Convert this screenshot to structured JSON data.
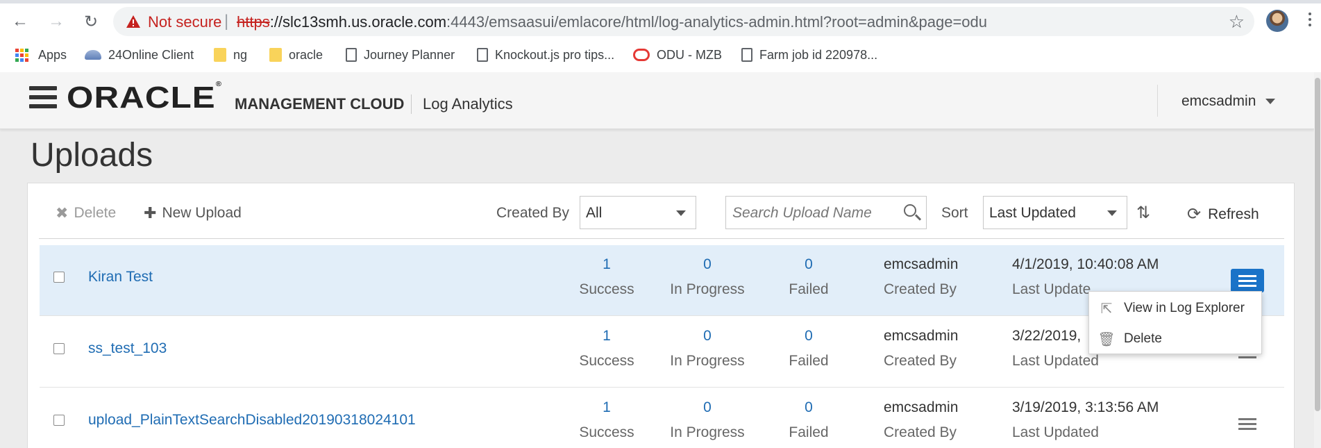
{
  "browser": {
    "security_label": "Not secure",
    "url_scheme": "https",
    "url_host": "://slc13smh.us.oracle.com",
    "url_rest": ":4443/emsaasui/emlacore/html/log-analytics-admin.html?root=admin&page=odu",
    "bookmarks": [
      {
        "label": "Apps",
        "icon": "apps-grid-icon"
      },
      {
        "label": "24Online Client",
        "icon": "cloud-icon"
      },
      {
        "label": "ng",
        "icon": "folder-icon"
      },
      {
        "label": "oracle",
        "icon": "folder-icon"
      },
      {
        "label": "Journey Planner",
        "icon": "page-icon"
      },
      {
        "label": "Knockout.js pro tips...",
        "icon": "page-icon"
      },
      {
        "label": "ODU - MZB",
        "icon": "oracle-o-icon"
      },
      {
        "label": "Farm job id 220978...",
        "icon": "page-icon"
      }
    ]
  },
  "header": {
    "logo": "ORACLE",
    "product": "MANAGEMENT CLOUD",
    "service": "Log Analytics",
    "user": "emcsadmin"
  },
  "page": {
    "title": "Uploads"
  },
  "toolbar": {
    "delete_label": "Delete",
    "new_upload_label": "New Upload",
    "created_by_label": "Created By",
    "created_by_value": "All",
    "search_placeholder": "Search Upload Name",
    "sort_label": "Sort",
    "sort_value": "Last Updated",
    "refresh_label": "Refresh"
  },
  "captions": {
    "success": "Success",
    "in_progress": "In Progress",
    "failed": "Failed",
    "created_by": "Created By",
    "last_updated": "Last Updated"
  },
  "uploads": [
    {
      "name": "Kiran Test",
      "success": "1",
      "in_progress": "0",
      "failed": "0",
      "created_by": "emcsadmin",
      "last_updated": "4/1/2019, 10:40:08 AM",
      "last_updated_caption": "Last Update",
      "selected": true
    },
    {
      "name": "ss_test_103",
      "success": "1",
      "in_progress": "0",
      "failed": "0",
      "created_by": "emcsadmin",
      "last_updated": "3/22/2019, ",
      "last_updated_caption": "Last Updated",
      "selected": false
    },
    {
      "name": "upload_PlainTextSearchDisabled20190318024101",
      "success": "1",
      "in_progress": "0",
      "failed": "0",
      "created_by": "emcsadmin",
      "last_updated": "3/19/2019, 3:13:56 AM",
      "last_updated_caption": "Last Updated",
      "selected": false
    }
  ],
  "row_menu": {
    "view_in_log_explorer": "View in Log Explorer",
    "delete": "Delete"
  },
  "colors": {
    "link": "#1f6cb3",
    "selected_row": "#e2eef9",
    "active_menu_button": "#1a73c8",
    "not_secure": "#c5221f"
  }
}
